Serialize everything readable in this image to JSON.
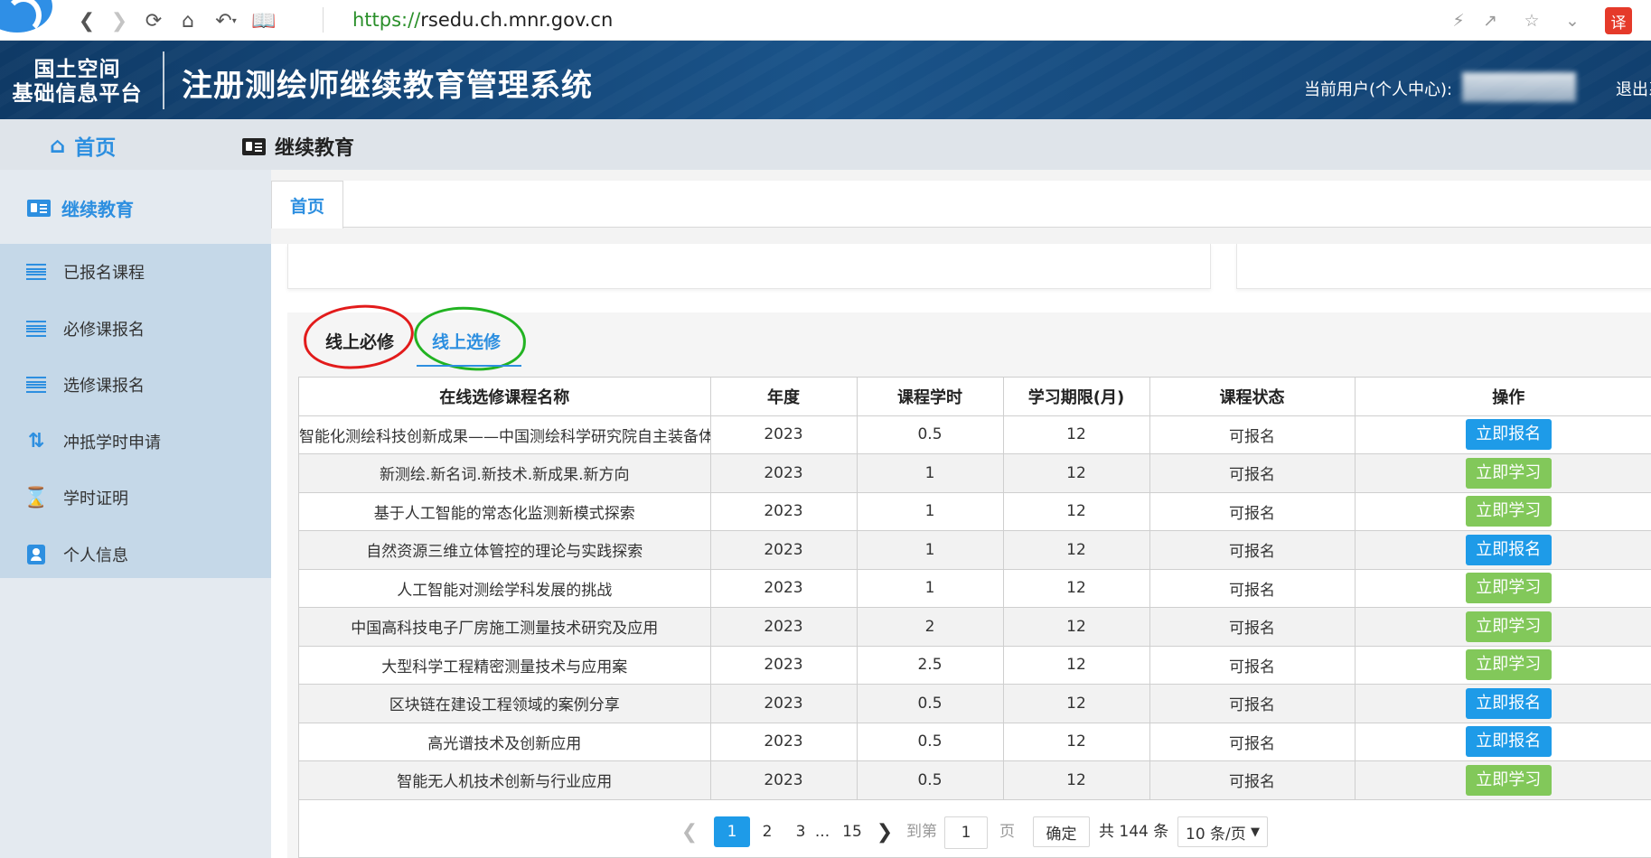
{
  "browser": {
    "url_scheme": "https://",
    "url_host": "rsedu.ch.mnr.gov.cn",
    "translate_label": "译",
    "icons": [
      "back-icon",
      "forward-icon",
      "reload-icon",
      "home-icon",
      "undo-icon",
      "reader-icon",
      "lightning-icon",
      "share-icon",
      "star-icon",
      "chevron-down-icon",
      "translate-icon"
    ]
  },
  "header": {
    "org_line1": "国土空间",
    "org_line2": "基础信息平台",
    "system_title": "注册测绘师继续教育管理系统",
    "current_user_label": "当前用户(个人中心):",
    "logout_label": "退出系"
  },
  "top_nav": {
    "home_label": "首页",
    "edu_label": "继续教育"
  },
  "sidebar": {
    "title": "继续教育",
    "items": [
      {
        "label": "已报名课程",
        "icon": "list-icon"
      },
      {
        "label": "必修课报名",
        "icon": "list-icon"
      },
      {
        "label": "选修课报名",
        "icon": "list-icon"
      },
      {
        "label": "冲抵学时申请",
        "icon": "compress-icon"
      },
      {
        "label": "学时证明",
        "icon": "hourglass-icon"
      },
      {
        "label": "个人信息",
        "icon": "person-card-icon"
      }
    ]
  },
  "page_tabs": {
    "home": "首页"
  },
  "course_tabs": {
    "required": "线上必修",
    "elective": "线上选修"
  },
  "table": {
    "headers": [
      "在线选修课程名称",
      "年度",
      "课程学时",
      "学习期限(月)",
      "课程状态",
      "操作"
    ],
    "rows": [
      {
        "name": "智能化测绘科技创新成果——中国测绘科学研究院自主装备体系",
        "year": "2023",
        "hours": "0.5",
        "period": "12",
        "status": "可报名",
        "action": "立即报名",
        "action_type": "signup"
      },
      {
        "name": "新测绘.新名词.新技术.新成果.新方向",
        "year": "2023",
        "hours": "1",
        "period": "12",
        "status": "可报名",
        "action": "立即学习",
        "action_type": "study"
      },
      {
        "name": "基于人工智能的常态化监测新模式探索",
        "year": "2023",
        "hours": "1",
        "period": "12",
        "status": "可报名",
        "action": "立即学习",
        "action_type": "study"
      },
      {
        "name": "自然资源三维立体管控的理论与实践探索",
        "year": "2023",
        "hours": "1",
        "period": "12",
        "status": "可报名",
        "action": "立即报名",
        "action_type": "signup"
      },
      {
        "name": "人工智能对测绘学科发展的挑战",
        "year": "2023",
        "hours": "1",
        "period": "12",
        "status": "可报名",
        "action": "立即学习",
        "action_type": "study"
      },
      {
        "name": "中国高科技电子厂房施工测量技术研究及应用",
        "year": "2023",
        "hours": "2",
        "period": "12",
        "status": "可报名",
        "action": "立即学习",
        "action_type": "study"
      },
      {
        "name": "大型科学工程精密测量技术与应用案",
        "year": "2023",
        "hours": "2.5",
        "period": "12",
        "status": "可报名",
        "action": "立即学习",
        "action_type": "study"
      },
      {
        "name": "区块链在建设工程领域的案例分享",
        "year": "2023",
        "hours": "0.5",
        "period": "12",
        "status": "可报名",
        "action": "立即报名",
        "action_type": "signup"
      },
      {
        "name": "高光谱技术及创新应用",
        "year": "2023",
        "hours": "0.5",
        "period": "12",
        "status": "可报名",
        "action": "立即报名",
        "action_type": "signup"
      },
      {
        "name": "智能无人机技术创新与行业应用",
        "year": "2023",
        "hours": "0.5",
        "period": "12",
        "status": "可报名",
        "action": "立即学习",
        "action_type": "study"
      }
    ]
  },
  "pagination": {
    "current": "1",
    "page2": "2",
    "page3": "3",
    "ellipsis": "...",
    "last": "15",
    "goto_label": "到第",
    "goto_value": "1",
    "page_label": "页",
    "confirm_label": "确定",
    "total_label": "共 144 条",
    "page_size": "10 条/页"
  },
  "colors": {
    "header_bg": "#1a5389",
    "accent": "#2d8fe0",
    "signup_button": "#1e9be8",
    "study_button": "#82c85a",
    "annotation_red": "#e21b1b",
    "annotation_green": "#22b322"
  }
}
